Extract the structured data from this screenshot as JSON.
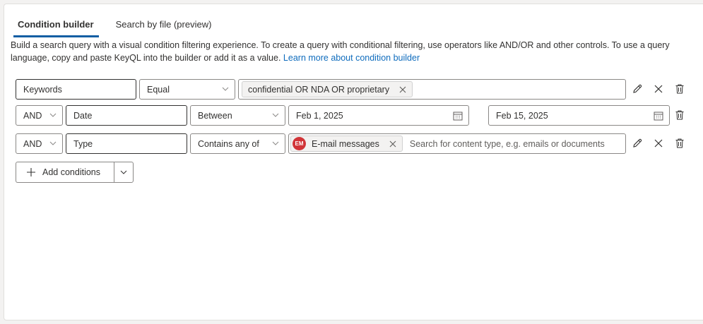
{
  "tabs": [
    {
      "label": "Condition builder",
      "active": true
    },
    {
      "label": "Search by file (preview)",
      "active": false
    }
  ],
  "description": {
    "text": "Build a search query with a visual condition filtering experience. To create a query with conditional filtering, use operators like AND/OR and other controls. To use a query language, copy and paste KeyQL into the builder or add it as a value.",
    "link": "Learn more about condition builder"
  },
  "rows": [
    {
      "property": "Keywords",
      "operator": "Equal",
      "value_chip": "confidential OR NDA OR proprietary"
    },
    {
      "logic": "AND",
      "property": "Date",
      "operator": "Between",
      "start_date": "Feb 1, 2025",
      "end_date": "Feb 15, 2025"
    },
    {
      "logic": "AND",
      "property": "Type",
      "operator": "Contains any of",
      "chip_initials": "EM",
      "chip_label": "E-mail messages",
      "placeholder": "Search for content type, e.g. emails or documents"
    }
  ],
  "add_button": {
    "label": "Add conditions"
  },
  "colors": {
    "accent": "#115ea3",
    "link": "#0f6cbd",
    "avatar": "#d13438"
  },
  "icons": [
    "pencil-icon",
    "close-icon",
    "trash-icon",
    "chevron-down-icon",
    "calendar-icon",
    "plus-icon",
    "dismiss-icon"
  ]
}
